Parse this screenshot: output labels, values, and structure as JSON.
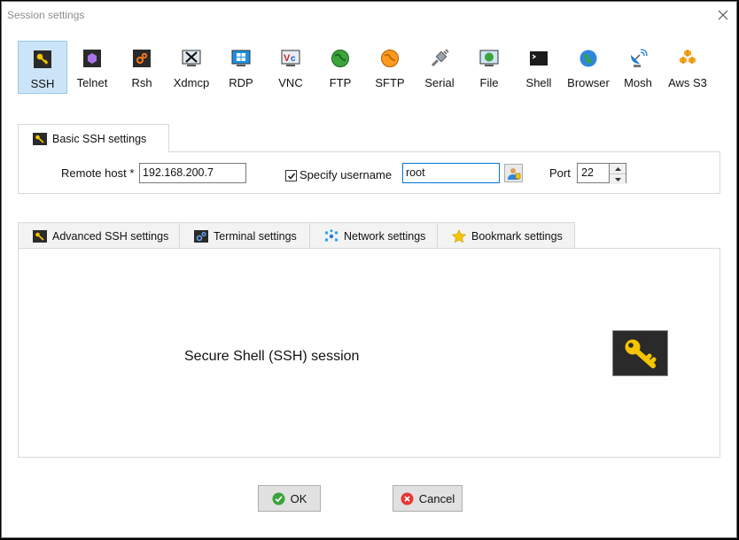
{
  "window": {
    "title": "Session settings"
  },
  "protocols": [
    {
      "label": "SSH",
      "icon": "key-icon",
      "selected": true
    },
    {
      "label": "Telnet",
      "icon": "telnet-icon"
    },
    {
      "label": "Rsh",
      "icon": "rsh-icon"
    },
    {
      "label": "Xdmcp",
      "icon": "xdmcp-icon"
    },
    {
      "label": "RDP",
      "icon": "rdp-icon"
    },
    {
      "label": "VNC",
      "icon": "vnc-icon"
    },
    {
      "label": "FTP",
      "icon": "ftp-globe-icon"
    },
    {
      "label": "SFTP",
      "icon": "sftp-globe-icon"
    },
    {
      "label": "Serial",
      "icon": "serial-plug-icon"
    },
    {
      "label": "File",
      "icon": "file-monitor-icon"
    },
    {
      "label": "Shell",
      "icon": "shell-terminal-icon"
    },
    {
      "label": "Browser",
      "icon": "browser-globe-icon"
    },
    {
      "label": "Mosh",
      "icon": "mosh-satellite-icon"
    },
    {
      "label": "Aws S3",
      "icon": "aws-s3-cubes-icon"
    }
  ],
  "basic": {
    "tab_label": "Basic SSH settings",
    "remote_host_label": "Remote host *",
    "remote_host_value": "192.168.200.7",
    "specify_username_label": "Specify username",
    "specify_username_checked": true,
    "username_value": "root",
    "port_label": "Port",
    "port_value": "22"
  },
  "subtabs": [
    {
      "label": "Advanced SSH settings",
      "icon": "wrench-key-icon"
    },
    {
      "label": "Terminal settings",
      "icon": "terminal-settings-icon"
    },
    {
      "label": "Network settings",
      "icon": "network-icon"
    },
    {
      "label": "Bookmark settings",
      "icon": "star-icon"
    }
  ],
  "session_description": "Secure Shell (SSH) session",
  "buttons": {
    "ok": "OK",
    "cancel": "Cancel"
  },
  "colors": {
    "selected_bg": "#cce4f7",
    "accent": "#0078d7",
    "key_yellow": "#f5c400"
  }
}
